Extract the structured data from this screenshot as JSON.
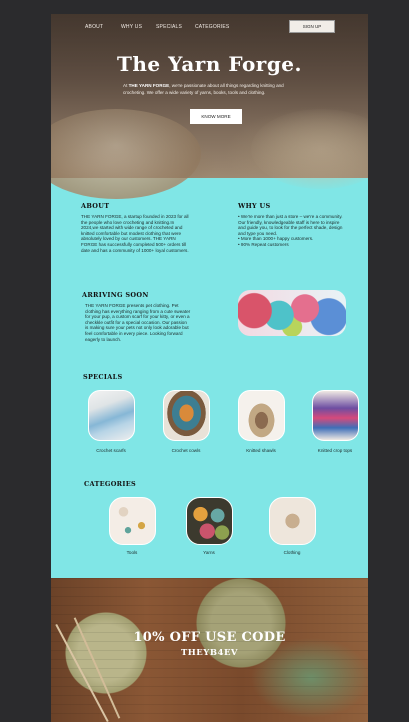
{
  "nav": {
    "items": [
      "ABOUT",
      "WHY US",
      "SPECIALS",
      "CATEGORIES"
    ],
    "signup": "SIGN UP"
  },
  "hero": {
    "title": "The Yarn Forge.",
    "sub_prefix": "At ",
    "sub_brand": "THE YARN FORGE",
    "sub_rest": ", we're passionate about all things regarding knitting and crocheting. We offer a wide variety of yarns, books, tools and clothing.",
    "button": "KNOW MORE"
  },
  "about": {
    "heading": "ABOUT",
    "text": "THE YARN FORGE, a startup founded in 2023 for all the people who love crocheting and knitting.In 2024,we started with wide range of crocheted and knitted comfortable but modest clothing that were absolutely loved by our customers. THE YARN FORGE has successfully completed 500+ orders till date and has a community of 1000+ loyal customers."
  },
  "why_us": {
    "heading": "WHY US",
    "lines": [
      "• We're more than just a store – we're a community. Our friendly, knowledgeable staff is here to inspire and guide you, to look for the perfect shade, design and type you need.",
      "• More than 1000+ happy customers.",
      "• 90% Repeat customers"
    ]
  },
  "arriving": {
    "heading": "ARRIVING SOON",
    "text": "THE YARN FORGE presents pet clothing. Pet clothing has everything ranging from a cute sweater for your pup, a custom scarf for your kitty, or even a checkkle outfit for a special occasion. Our passion is making sure your pets not only look adorable but feel comfortable in every piece. Looking forward eagerly to launch."
  },
  "specials": {
    "heading": "SPECIALS",
    "items": [
      "Crochet scarfs",
      "Crochet cowls",
      "Knitted shawls",
      "Knitted crop tops"
    ]
  },
  "categories": {
    "heading": "CATEGORIES",
    "items": [
      "Tools",
      "Yarns",
      "Clothing"
    ]
  },
  "promo": {
    "title": "10% OFF USE CODE",
    "code": "THEYB4EV"
  }
}
